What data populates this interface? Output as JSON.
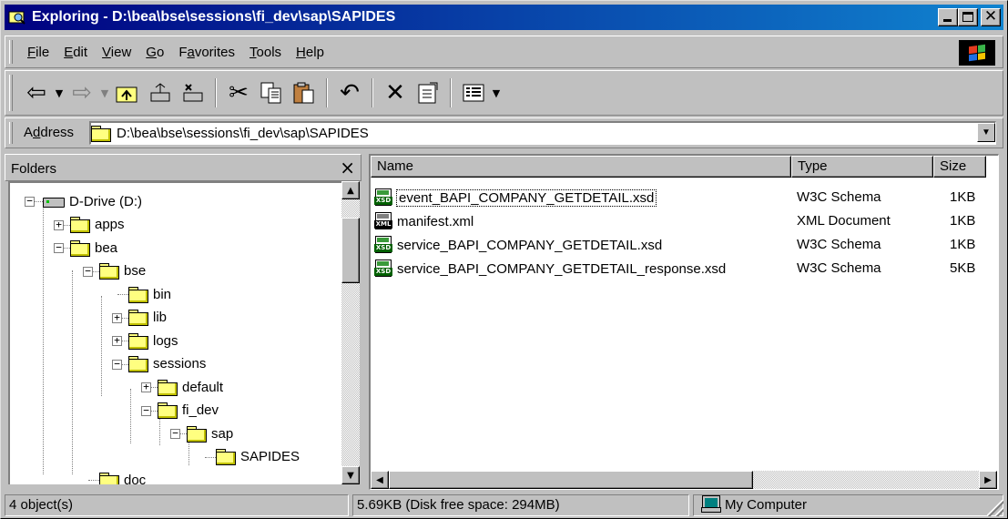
{
  "window": {
    "title": "Exploring - D:\\bea\\bse\\sessions\\fi_dev\\sap\\SAPIDES"
  },
  "menu": [
    {
      "label": "File",
      "accel": "F",
      "rest": "ile"
    },
    {
      "label": "Edit",
      "accel": "E",
      "rest": "dit"
    },
    {
      "label": "View",
      "accel": "V",
      "rest": "iew"
    },
    {
      "label": "Go",
      "accel": "G",
      "rest": "o"
    },
    {
      "label": "Favorites",
      "pre": "F",
      "accel": "a",
      "rest": "vorites"
    },
    {
      "label": "Tools",
      "accel": "T",
      "rest": "ools"
    },
    {
      "label": "Help",
      "accel": "H",
      "rest": "elp"
    }
  ],
  "toolbar": {
    "icons": [
      "back-icon",
      "forward-icon",
      "up-folder-icon",
      "map-drive-icon",
      "disconnect-drive-icon",
      "cut-icon",
      "copy-icon",
      "paste-icon",
      "undo-icon",
      "delete-icon",
      "properties-icon",
      "views-icon"
    ]
  },
  "address": {
    "label_pre": "A",
    "label_accel": "d",
    "label_rest": "dress",
    "value": "D:\\bea\\bse\\sessions\\fi_dev\\sap\\SAPIDES"
  },
  "folders_pane": {
    "title": "Folders",
    "close": "×",
    "tree": [
      {
        "label": "D-Drive (D:)",
        "type": "drive",
        "expanded": true
      },
      {
        "label": "apps",
        "type": "folder",
        "expanded": false
      },
      {
        "label": "bea",
        "type": "folder",
        "expanded": true
      },
      {
        "label": "bse",
        "type": "folder",
        "expanded": true
      },
      {
        "label": "bin",
        "type": "folder"
      },
      {
        "label": "lib",
        "type": "folder",
        "expanded": false
      },
      {
        "label": "logs",
        "type": "folder",
        "expanded": false
      },
      {
        "label": "sessions",
        "type": "folder",
        "expanded": true
      },
      {
        "label": "default",
        "type": "folder",
        "expanded": false
      },
      {
        "label": "fi_dev",
        "type": "folder",
        "expanded": true
      },
      {
        "label": "sap",
        "type": "folder",
        "expanded": true
      },
      {
        "label": "SAPIDES",
        "type": "folder-open"
      },
      {
        "label": "doc",
        "type": "folder"
      }
    ]
  },
  "file_list": {
    "columns": [
      "Name",
      "Type",
      "Size"
    ],
    "rows": [
      {
        "name": "event_BAPI_COMPANY_GETDETAIL.xsd",
        "type": "W3C Schema",
        "size": "1KB",
        "icon": "xsd"
      },
      {
        "name": "manifest.xml",
        "type": "XML Document",
        "size": "1KB",
        "icon": "xml"
      },
      {
        "name": "service_BAPI_COMPANY_GETDETAIL.xsd",
        "type": "W3C Schema",
        "size": "1KB",
        "icon": "xsd"
      },
      {
        "name": "service_BAPI_COMPANY_GETDETAIL_response.xsd",
        "type": "W3C Schema",
        "size": "5KB",
        "icon": "xsd"
      }
    ]
  },
  "status": {
    "objects": "4 object(s)",
    "disk": "5.69KB (Disk free space: 294MB)",
    "location": "My Computer"
  },
  "colors": {
    "title_start": "#000080",
    "title_end": "#1084d0",
    "face": "#c0c0c0"
  }
}
